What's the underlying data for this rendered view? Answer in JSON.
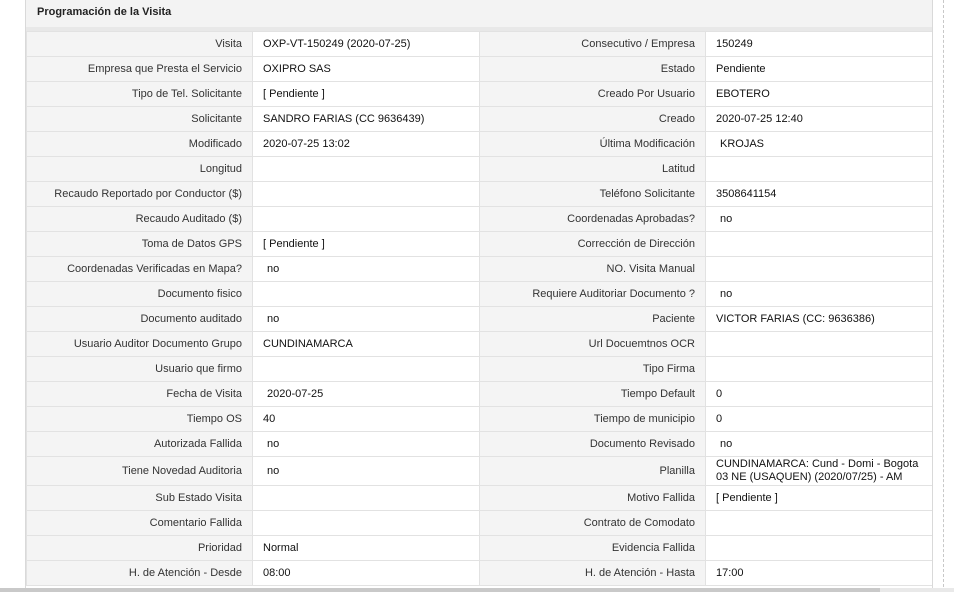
{
  "panel": {
    "title": "Programación de la Visita"
  },
  "rows": [
    {
      "l1": "Visita",
      "v1": "OXP-VT-150249 (2020-07-25)",
      "l2": "Consecutivo / Empresa",
      "v2": "150249"
    },
    {
      "l1": "Empresa que Presta el Servicio",
      "v1": "OXIPRO SAS",
      "l2": "Estado",
      "v2": "Pendiente"
    },
    {
      "l1": "Tipo de Tel. Solicitante",
      "v1": "[ Pendiente ]",
      "l2": "Creado Por Usuario",
      "v2": "EBOTERO"
    },
    {
      "l1": "Solicitante",
      "v1": "SANDRO FARIAS (CC 9636439)",
      "l2": "Creado",
      "v2": "2020-07-25 12:40"
    },
    {
      "l1": "Modificado",
      "v1": "2020-07-25 13:02",
      "l2": "Última Modificación",
      "v2": "KROJAS"
    },
    {
      "l1": "Longitud",
      "v1": "",
      "l2": "Latitud",
      "v2": ""
    },
    {
      "l1": "Recaudo Reportado por Conductor ($)",
      "v1": "",
      "l2": "Teléfono Solicitante",
      "v2": "3508641154"
    },
    {
      "l1": "Recaudo Auditado ($)",
      "v1": "",
      "l2": "Coordenadas Aprobadas?",
      "v2": "no"
    },
    {
      "l1": "Toma de Datos GPS",
      "v1": "[ Pendiente ]",
      "l2": "Corrección de Dirección",
      "v2": ""
    },
    {
      "l1": "Coordenadas Verificadas en Mapa?",
      "v1": "no",
      "l2": "NO. Visita Manual",
      "v2": ""
    },
    {
      "l1": "Documento fisico",
      "v1": "",
      "l2": "Requiere Auditoriar Documento ?",
      "v2": "no"
    },
    {
      "l1": "Documento auditado",
      "v1": "no",
      "l2": "Paciente",
      "v2": "VICTOR FARIAS (CC: 9636386)"
    },
    {
      "l1": "Usuario Auditor Documento Grupo",
      "v1": "CUNDINAMARCA",
      "l2": "Url Docuemtnos OCR",
      "v2": ""
    },
    {
      "l1": "Usuario que firmo",
      "v1": "",
      "l2": "Tipo Firma",
      "v2": ""
    },
    {
      "l1": "Fecha de Visita",
      "v1": "2020-07-25",
      "l2": "Tiempo Default",
      "v2": "0"
    },
    {
      "l1": "Tiempo OS",
      "v1": "40",
      "l2": "Tiempo de municipio",
      "v2": "0"
    },
    {
      "l1": "Autorizada Fallida",
      "v1": "no",
      "l2": "Documento Revisado",
      "v2": "no"
    },
    {
      "l1": "Tiene Novedad Auditoria",
      "v1": "no",
      "l2": "Planilla",
      "v2": "CUNDINAMARCA: Cund - Domi - Bogota 03 NE (USAQUEN) (2020/07/25) - AM"
    },
    {
      "l1": "Sub Estado Visita",
      "v1": "",
      "l2": "Motivo Fallida",
      "v2": "[ Pendiente ]"
    },
    {
      "l1": "Comentario Fallida",
      "v1": "",
      "l2": "Contrato de Comodato",
      "v2": ""
    },
    {
      "l1": "Prioridad",
      "v1": "Normal",
      "l2": "Evidencia Fallida",
      "v2": ""
    },
    {
      "l1": "H. de Atención - Desde",
      "v1": "08:00",
      "l2": "H. de Atención - Hasta",
      "v2": "17:00"
    }
  ]
}
